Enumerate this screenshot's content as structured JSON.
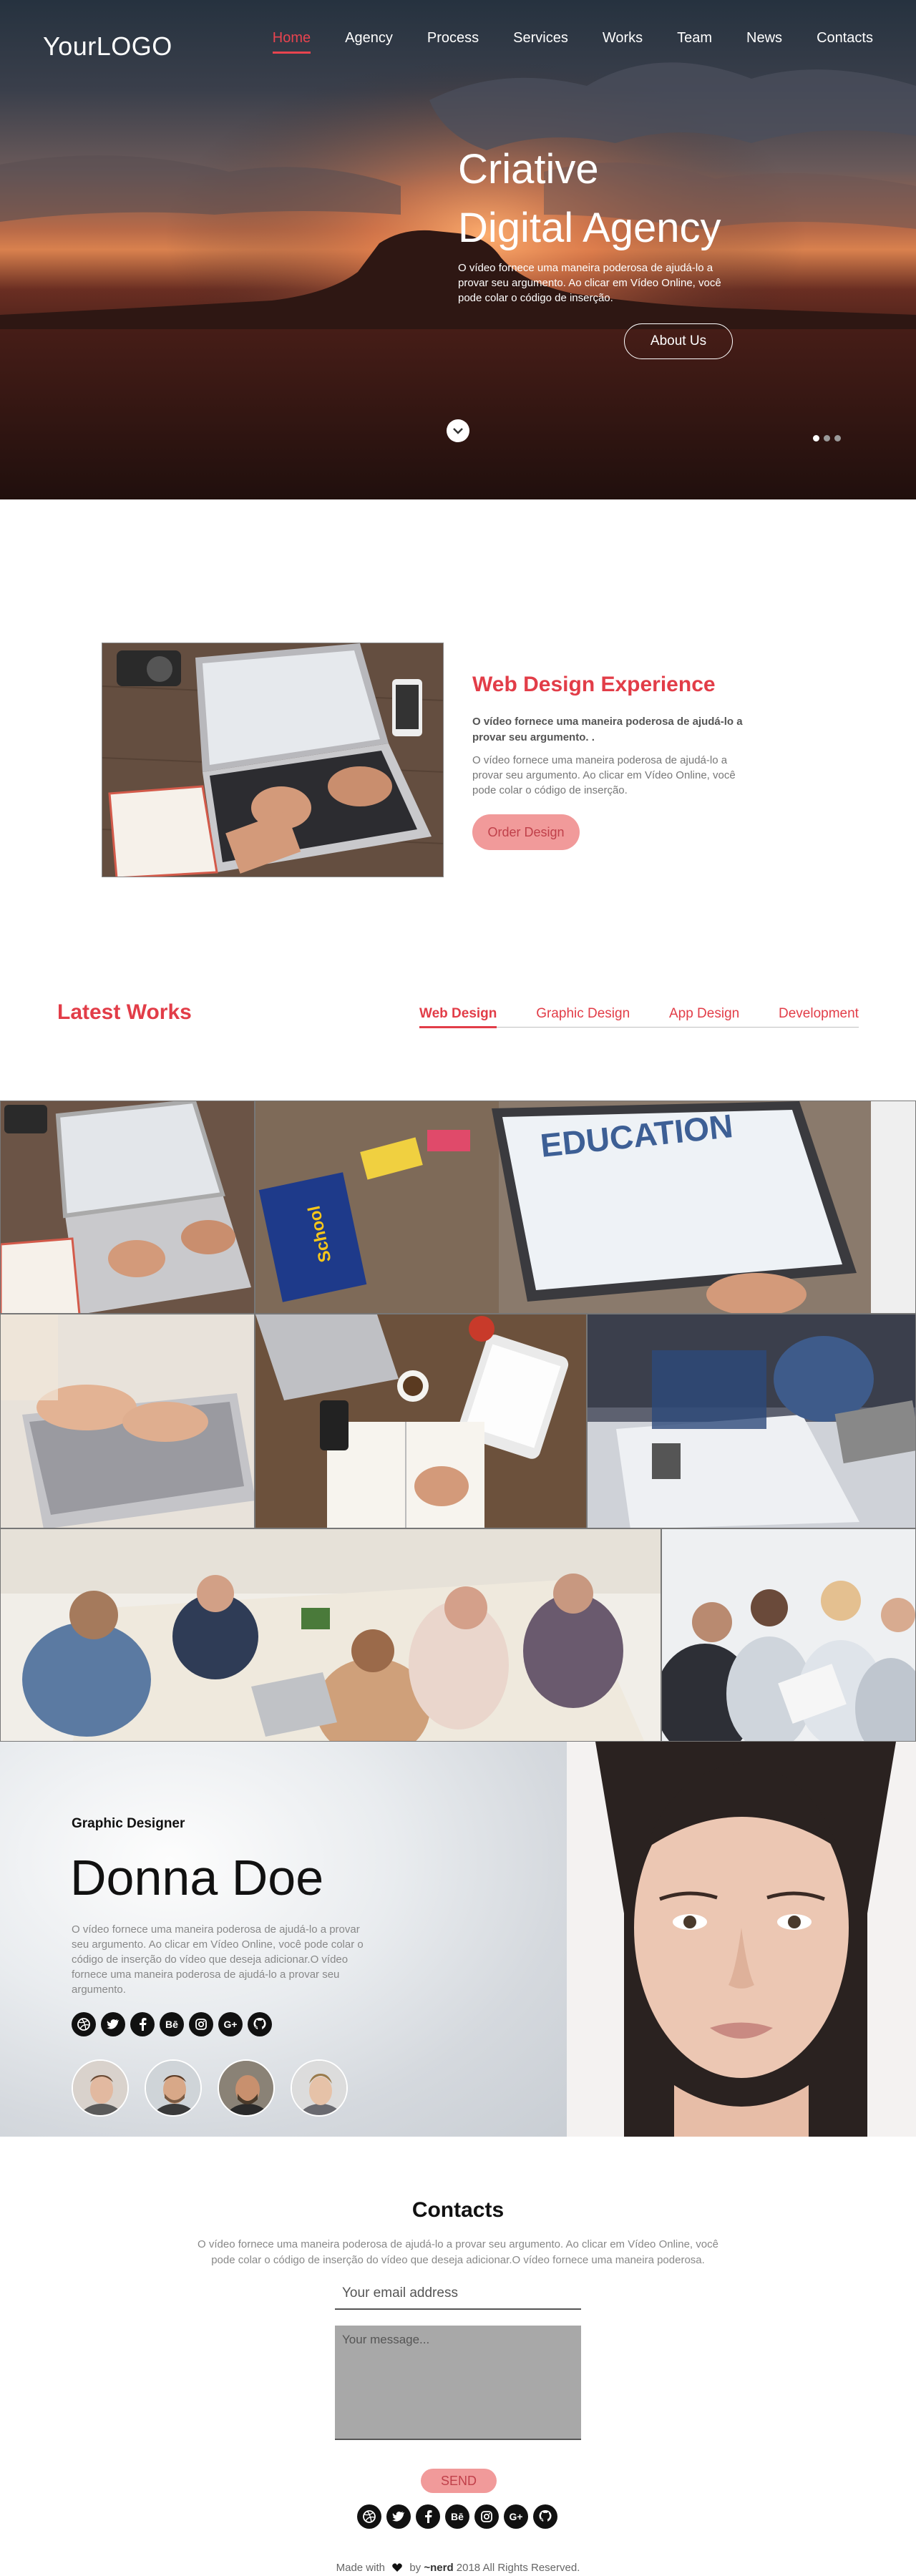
{
  "header": {
    "logo": "YourLOGO",
    "nav": [
      "Home",
      "Agency",
      "Process",
      "Services",
      "Works",
      "Team",
      "News",
      "Contacts"
    ],
    "active_nav": "Home"
  },
  "hero": {
    "title_line1": "Criative",
    "title_line2": "Digital Agency",
    "text": "O vídeo fornece uma maneira poderosa de ajudá-lo a provar seu argumento. Ao clicar em Vídeo Online, você pode colar o código de inserção.",
    "button": "About Us",
    "scroll_icon": "chevron-down-icon",
    "slides": 3,
    "active_slide": 1
  },
  "experience": {
    "title": "Web Design Experience",
    "bold_text": "O vídeo fornece uma maneira poderosa de ajudá-lo a provar seu argumento. .",
    "text": "O vídeo fornece uma maneira poderosa de ajudá-lo a provar seu argumento. Ao clicar em Vídeo Online, você pode colar o código de inserção.",
    "button": "Order Design"
  },
  "works": {
    "title": "Latest Works",
    "tabs": [
      "Web Design",
      "Graphic Design",
      "App Design",
      "Development"
    ],
    "active_tab": "Web Design"
  },
  "profile": {
    "role": "Graphic Designer",
    "name": "Donna Doe",
    "bio": "O vídeo fornece uma maneira poderosa de ajudá-lo a provar seu argumento. Ao clicar em Vídeo Online, você pode colar o código de inserção do vídeo que deseja adicionar.O vídeo fornece uma maneira poderosa de ajudá-lo a provar seu argumento.",
    "socials": [
      "dribbble-icon",
      "twitter-icon",
      "facebook-icon",
      "behance-icon",
      "instagram-icon",
      "google-plus-icon",
      "github-icon"
    ]
  },
  "contacts": {
    "title": "Contacts",
    "text": "O vídeo fornece uma maneira poderosa de ajudá-lo a provar seu argumento. Ao clicar em Vídeo Online, você pode colar o código de inserção do vídeo que deseja adicionar.O vídeo fornece uma maneira poderosa.",
    "email_placeholder": "Your email address",
    "message_placeholder": "Your message...",
    "send": "SEND"
  },
  "footer": {
    "made_with": "Made with",
    "by": "by",
    "author": "~nerd",
    "rights": "2018 All Rights Reserved.",
    "heart_icon": "heart-icon"
  },
  "colors": {
    "accent": "#e23d48",
    "button_pink": "#f19a9a"
  }
}
